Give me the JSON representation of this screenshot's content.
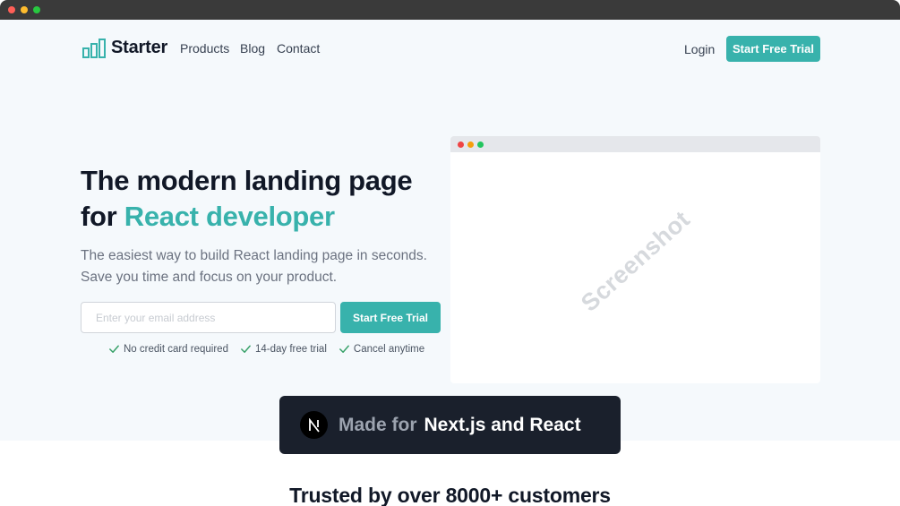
{
  "window": {
    "dot_colors": [
      "#ff5f57",
      "#febc2e",
      "#28c840"
    ]
  },
  "nav": {
    "logo_text": "Starter",
    "links": [
      "Products",
      "Blog",
      "Contact"
    ],
    "login_label": "Login",
    "cta_label": "Start Free Trial"
  },
  "hero": {
    "title_line1": "The modern landing page",
    "title_prefix": "for ",
    "title_accent": "React developer",
    "subtitle": "The easiest way to build React landing page in seconds. Save you time and focus on your product.",
    "email_placeholder": "Enter your email address",
    "cta_label": "Start Free Trial",
    "features": [
      "No credit card required",
      "14-day free trial",
      "Cancel anytime"
    ]
  },
  "mock": {
    "watermark": "Screenshot",
    "dot_colors": [
      "#ef4444",
      "#f59e0b",
      "#22c55e"
    ]
  },
  "banner": {
    "prefix": "Made for",
    "main": "Next.js and React",
    "logo_letter": "N"
  },
  "trusted": {
    "title": "Trusted by over 8000+ customers"
  },
  "colors": {
    "accent": "#38b2ac",
    "banner_bg": "#1a202c",
    "hero_bg": "#f5f9fc"
  }
}
